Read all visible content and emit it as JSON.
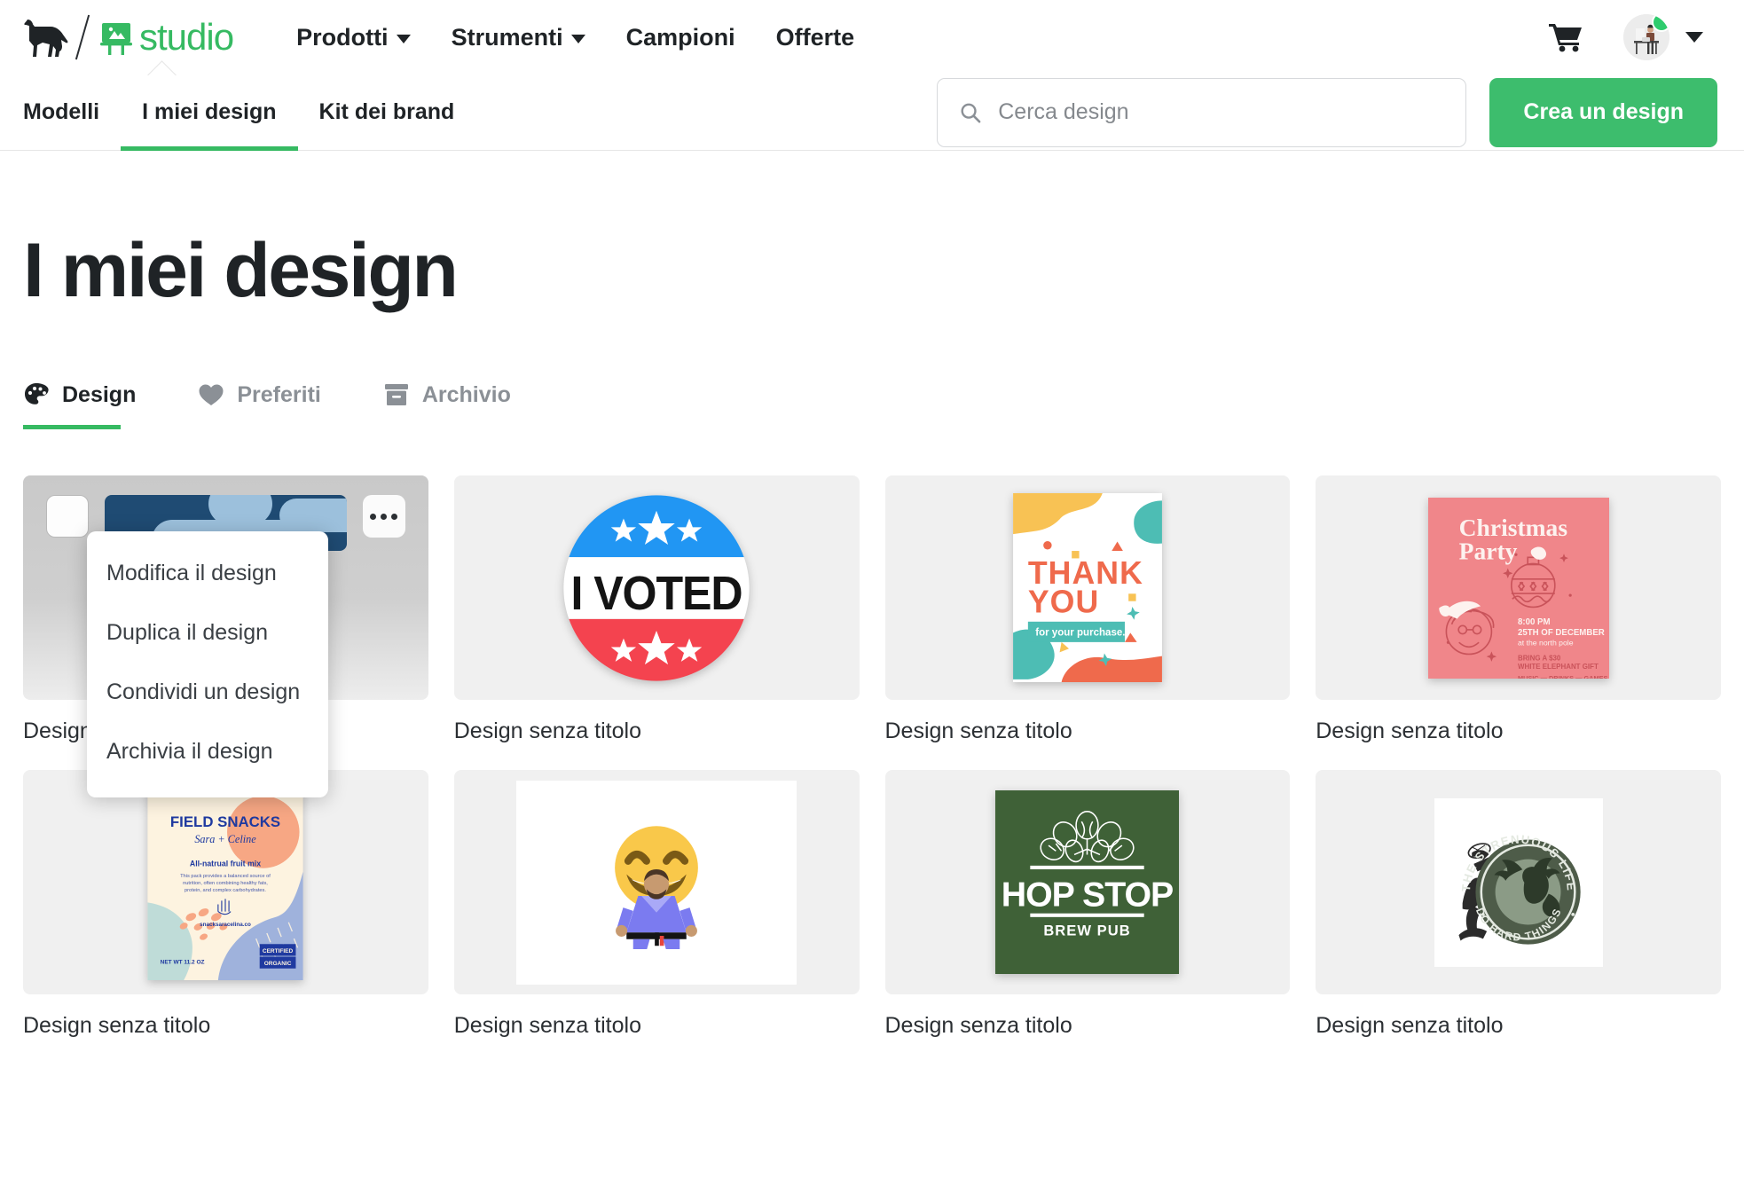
{
  "topnav": {
    "logo_name": "sticker-mule-horse",
    "brand_word": "studio",
    "links": [
      {
        "label": "Prodotti",
        "has_caret": true
      },
      {
        "label": "Strumenti",
        "has_caret": true
      },
      {
        "label": "Campioni",
        "has_caret": false
      },
      {
        "label": "Offerte",
        "has_caret": false
      }
    ],
    "cart_icon": "shopping-cart-icon",
    "avatar_icon": "user-avatar",
    "avatar_status": "online",
    "avatar_caret": "chevron-down-icon"
  },
  "subnav": {
    "tabs": [
      {
        "label": "Modelli",
        "active": false
      },
      {
        "label": "I miei design",
        "active": true
      },
      {
        "label": "Kit dei brand",
        "active": false
      }
    ],
    "search": {
      "icon": "search-icon",
      "value": "",
      "placeholder": "Cerca design"
    },
    "create_button": "Crea un design"
  },
  "main": {
    "page_title": "I miei design",
    "filters": [
      {
        "label": "Design",
        "icon": "palette-icon",
        "active": true
      },
      {
        "label": "Preferiti",
        "icon": "heart-icon",
        "active": false
      },
      {
        "label": "Archivio",
        "icon": "archive-box-icon",
        "active": false
      }
    ],
    "context_menu": {
      "items": [
        "Modifica il design",
        "Duplica il design",
        "Condividi un design",
        "Archivia il design"
      ]
    },
    "cards": [
      {
        "label": "Design senza titolo",
        "art": "camo-banner",
        "selected": true
      },
      {
        "label": "Design senza titolo",
        "art": "i-voted",
        "selected": false
      },
      {
        "label": "Design senza titolo",
        "art": "thank-you",
        "selected": false
      },
      {
        "label": "Design senza titolo",
        "art": "christmas",
        "selected": false
      },
      {
        "label": "Design senza titolo",
        "art": "field-snacks",
        "selected": false
      },
      {
        "label": "Design senza titolo",
        "art": "emoji-judo",
        "selected": false
      },
      {
        "label": "Design senza titolo",
        "art": "hop-stop",
        "selected": false
      },
      {
        "label": "Design senza titolo",
        "art": "strenuous",
        "selected": false
      }
    ]
  },
  "artwork_text": {
    "i_voted": "I VOTED",
    "thank_you_line1": "THANK",
    "thank_you_line2": "YOU",
    "thank_you_tag": "for your purchase.",
    "christmas_line1": "Christmas",
    "christmas_line2": "Party",
    "christmas_time": "8:00 PM",
    "christmas_date": "25TH OF DECEMBER",
    "christmas_place": "at the north pole",
    "christmas_gift1": "BRING A $30",
    "christmas_gift2": "WHITE ELEPHANT GIFT",
    "christmas_foot": "MUSIC — DRINKS — GAMES",
    "snacks_title": "FIELD SNACKS",
    "snacks_script": "Sara + Celine",
    "snacks_sub": "All-natrual fruit mix",
    "snacks_body": "This pack provides a balanced source of nutrition, often combining healthy fats, protein, and complex carbohydrates.",
    "snacks_url": "snacksaracelina.co",
    "snacks_badge1": "CERTIFIED",
    "snacks_badge2": "ORGANIC",
    "snacks_weight": "NET WT 11.2 OZ",
    "hop_title": "HOP STOP",
    "hop_sub": "BREW PUB",
    "stren_top": "THE STRENUOUS LIFE",
    "stren_bottom": "DO HARD THINGS"
  },
  "colors": {
    "brand_green": "#36ba62",
    "button_green": "#3dbd6d",
    "status_green": "#2ecc6d",
    "text_dark": "#1f2326",
    "text_muted": "#8b9096",
    "thumb_bg": "#f0f0f0",
    "vote_blue": "#2196f3",
    "vote_red": "#f4434f",
    "xmas_pink": "#f0868a",
    "hop_green": "#3f6137"
  }
}
